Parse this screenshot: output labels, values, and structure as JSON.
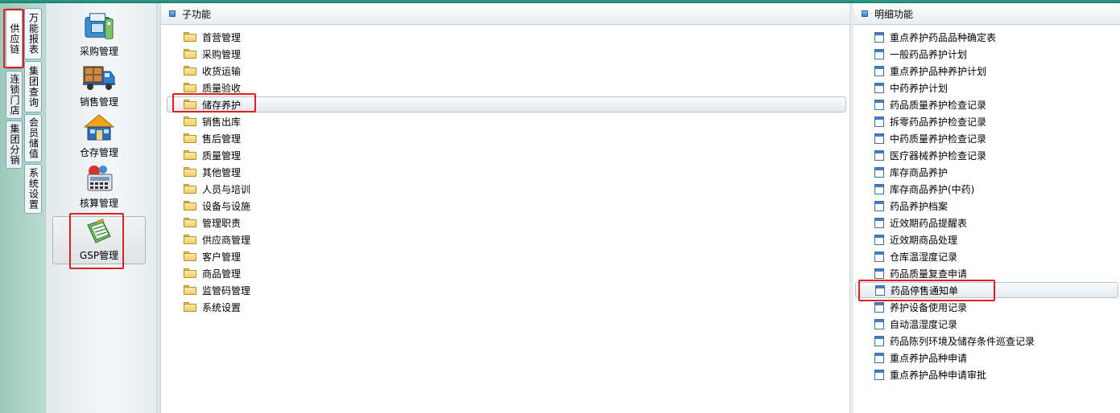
{
  "nav_tabs": {
    "supply_chain": "供应链",
    "chain_store": "连锁门店",
    "group_distribution": "集团分销",
    "universal_report": "万能报表",
    "group_query": "集团查询",
    "member_stored_value": "会员储值",
    "system_settings": "系统设置"
  },
  "modules": [
    {
      "label": "采购管理",
      "icon": "purchase-register-icon"
    },
    {
      "label": "销售管理",
      "icon": "delivery-truck-icon"
    },
    {
      "label": "仓存管理",
      "icon": "warehouse-house-icon"
    },
    {
      "label": "核算管理",
      "icon": "calculator-icon"
    },
    {
      "label": "GSP管理",
      "icon": "gsp-book-icon"
    }
  ],
  "sub_pane": {
    "title": "子功能",
    "items": [
      "首营管理",
      "采购管理",
      "收货运输",
      "质量验收",
      "储存养护",
      "销售出库",
      "售后管理",
      "质量管理",
      "其他管理",
      "人员与培训",
      "设备与设施",
      "管理职责",
      "供应商管理",
      "客户管理",
      "商品管理",
      "监管码管理",
      "系统设置"
    ],
    "selected": "储存养护"
  },
  "detail_pane": {
    "title": "明细功能",
    "items": [
      "重点养护药品品种确定表",
      "一般药品养护计划",
      "重点养护品种养护计划",
      "中药养护计划",
      "药品质量养护检查记录",
      "拆零药品养护检查记录",
      "中药质量养护检查记录",
      "医疗器械养护检查记录",
      "库存商品养护",
      "库存商品养护(中药)",
      "药品养护档案",
      "近效期药品提醒表",
      "近效期商品处理",
      "仓库温湿度记录",
      "药品质量复查申请",
      "药品停售通知单",
      "养护设备使用记录",
      "自动温湿度记录",
      "药品陈列环境及储存条件巡查记录",
      "重点养护品种申请",
      "重点养护品种申请审批"
    ],
    "selected": "药品停售通知单"
  },
  "colors": {
    "highlight": "#e02020",
    "accent": "#3b7fc4",
    "nav_bg": "#9ccab9"
  }
}
